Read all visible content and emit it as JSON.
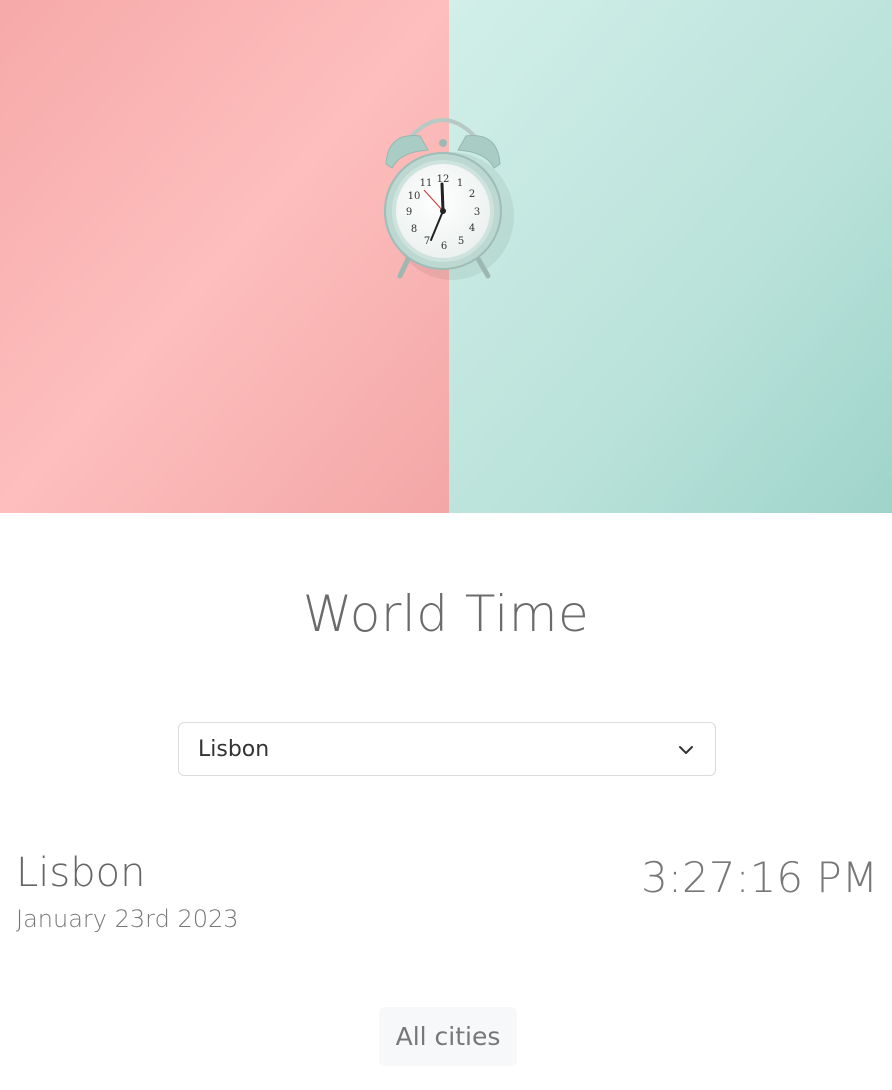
{
  "app": {
    "title": "World Time"
  },
  "hero": {
    "image": "alarm-clock-photo",
    "left_color": "#fdb7b6",
    "right_color": "#bfe5de"
  },
  "city_select": {
    "selected": "Lisbon",
    "icon": "chevron-down-icon"
  },
  "current_city": {
    "name": "Lisbon",
    "date": "January 23rd 2023",
    "time": "3:27:16 PM"
  },
  "actions": {
    "all_cities_label": "All cities"
  }
}
